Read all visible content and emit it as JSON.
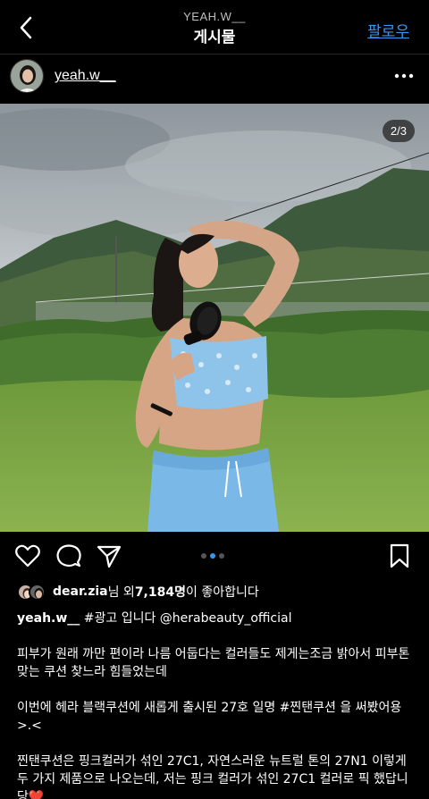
{
  "top_bar": {
    "username": "YEAH.W__",
    "title": "게시물",
    "follow_label": "팔로우"
  },
  "post": {
    "username": "yeah.w__",
    "image_counter": "2/3",
    "carousel_dots": 3,
    "active_dot": 1
  },
  "likes": {
    "liker": "dear.zia",
    "mid": "님 외 ",
    "count": "7,184명",
    "suffix": "이 좋아합니다"
  },
  "caption": {
    "username": "yeah.w__",
    "tags": "#광고 입니다 @herabeauty_official",
    "para1": "피부가 원래 까만 편이라 나름 어둡다는 컬러들도 제게는조금 밝아서 피부톤 맞는 쿠션 찾느라 힘들었는데",
    "para2": "이번에 헤라 블랙쿠션에 새롭게 출시된 27호 일명 #찐탠쿠션 을 써봤어용 >.<",
    "para3": "찐탠쿠션은 핑크컬러가 섞인 27C1, 자연스러운 뉴트럴 톤의 27N1 이렇게 두 가지 제품으로 나오는데, 저는 핑크 컬러가 섞인 27C1 컬러로 픽 했답니당❤️"
  },
  "icons": [
    "back-icon",
    "more-icon",
    "heart-icon",
    "comment-icon",
    "send-icon",
    "bookmark-icon"
  ],
  "colors": {
    "accent": "#3897f0",
    "background": "#000000"
  }
}
